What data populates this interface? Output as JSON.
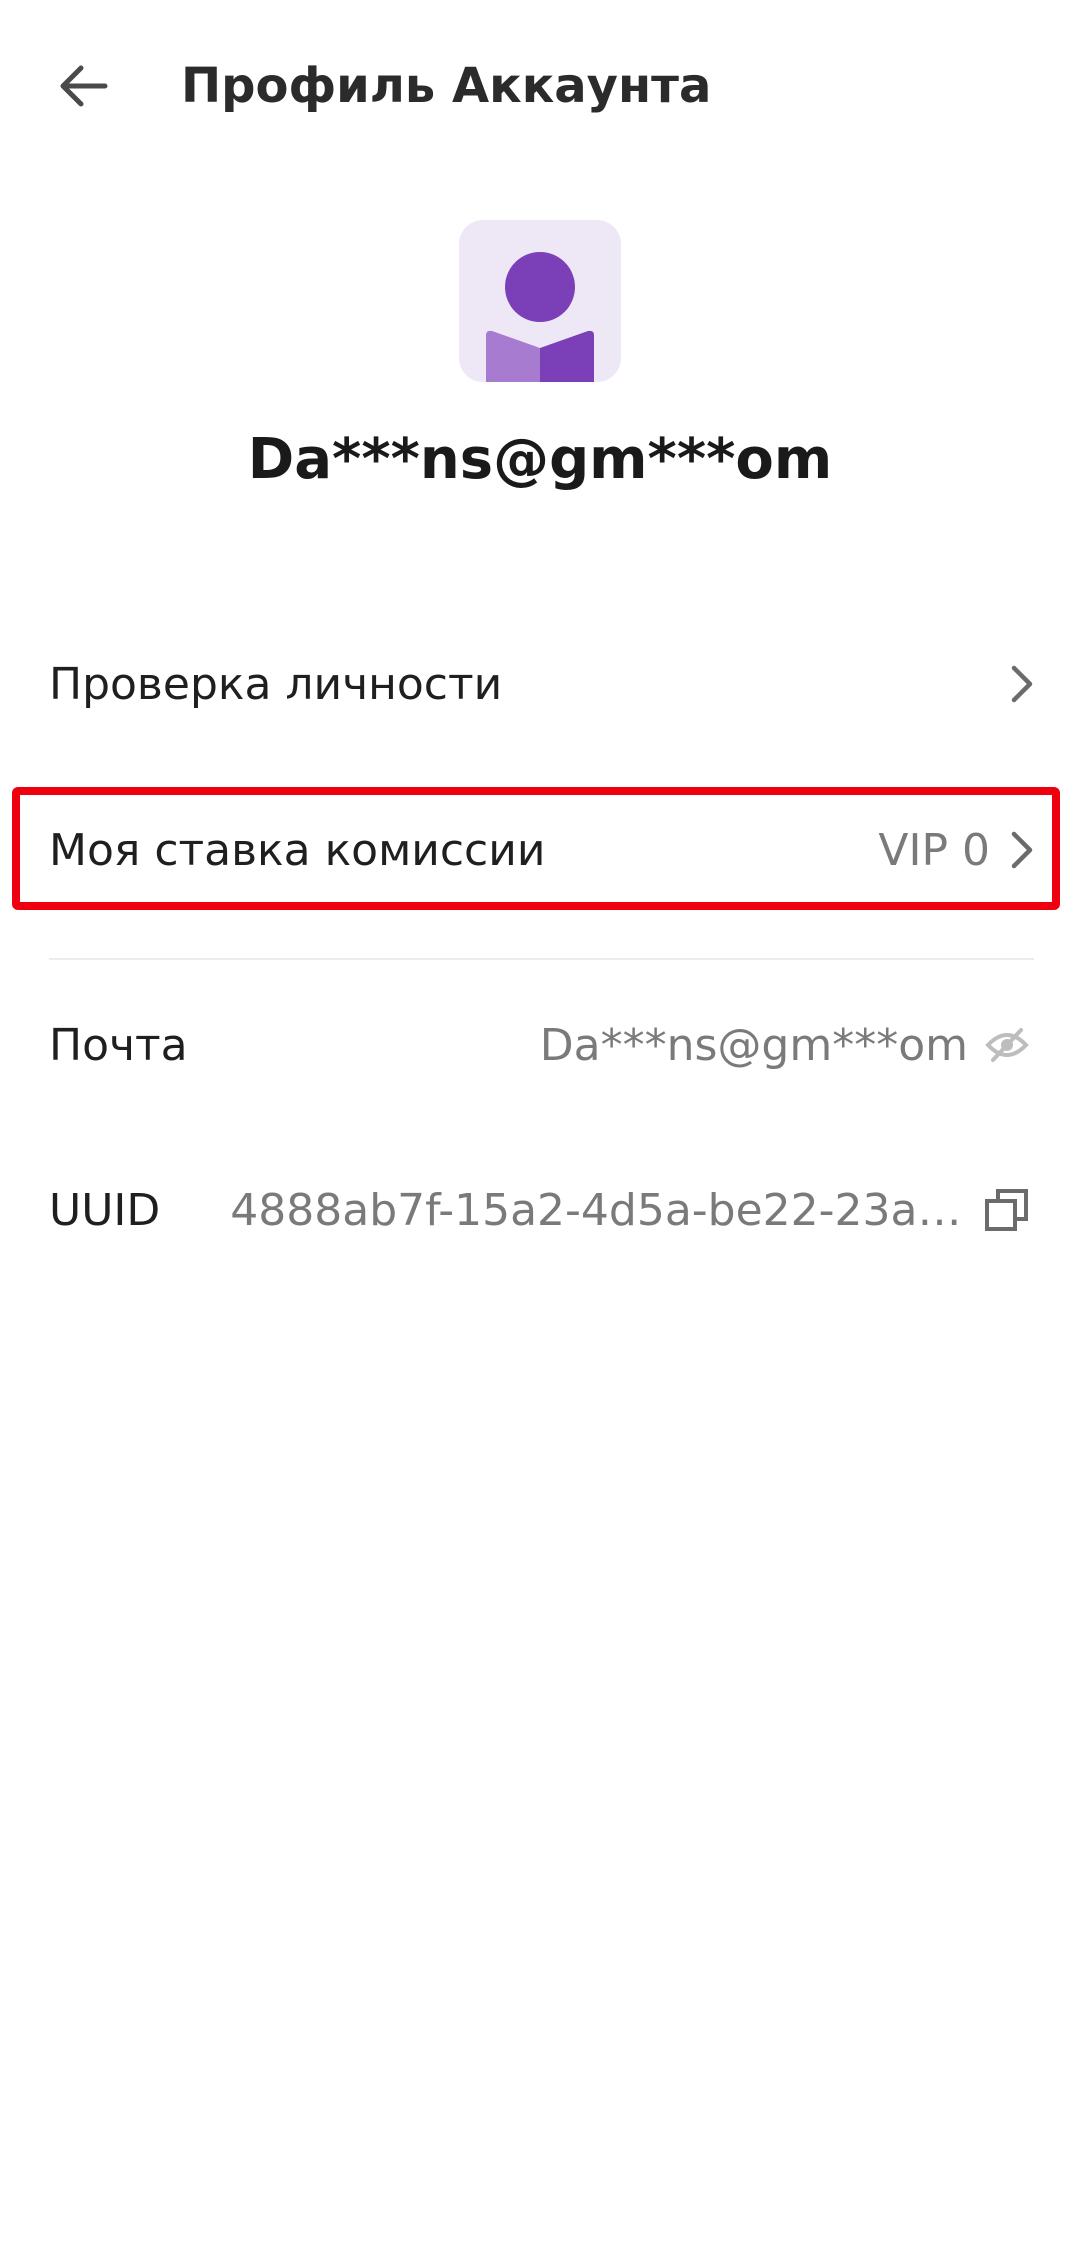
{
  "header": {
    "title": "Профиль Аккаунта",
    "back_icon": "arrow-left-icon"
  },
  "profile": {
    "avatar_icon": "user-avatar-icon",
    "email": "Da***ns@gm***om"
  },
  "rows": {
    "identity": {
      "label": "Проверка личности",
      "icon": "chevron-right-icon"
    },
    "commission": {
      "label": "Моя ставка комиссии",
      "value": "VIP 0",
      "icon": "chevron-right-icon"
    },
    "email": {
      "label": "Почта",
      "value": "Da***ns@gm***om",
      "icon": "eye-off-icon"
    },
    "uuid": {
      "label": "UUID",
      "value": "4888ab7f-15a2-4d5a-be22-23a11b3…",
      "icon": "copy-icon"
    }
  },
  "colors": {
    "accent": "#7b3fb8",
    "accent_light": "#ede7f6",
    "highlight": "#f0000f",
    "muted_text": "#7a7a7a"
  }
}
